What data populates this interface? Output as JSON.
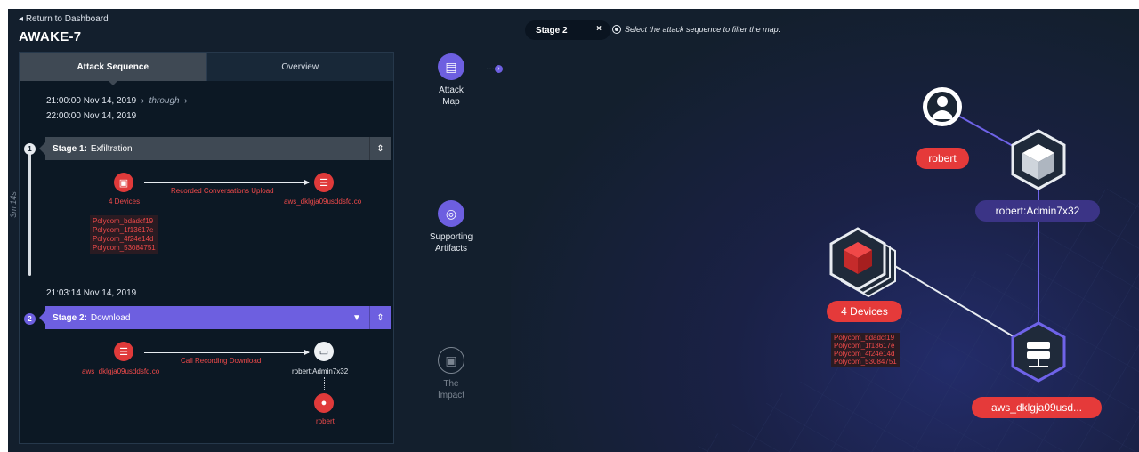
{
  "header": {
    "back_label": "Return to Dashboard",
    "title": "AWAKE-7"
  },
  "tabs": [
    {
      "label": "Attack Sequence"
    },
    {
      "label": "Overview"
    }
  ],
  "range": {
    "start": "21:00:00  Nov 14, 2019",
    "through": "through",
    "end": "22:00:00  Nov 14, 2019"
  },
  "duration": "3m 14s",
  "stage1": {
    "number": "1",
    "prefix": "Stage 1:",
    "name": "Exfiltration",
    "source_label": "4 Devices",
    "edge_label": "Recorded Conversations Upload",
    "target_label": "aws_dklgja09usddsfd.co",
    "devices": [
      "Polycom_bdadcf19",
      "Polycom_1f13617e",
      "Polycom_4f24e14d",
      "Polycom_53084751"
    ]
  },
  "stage2": {
    "time": "21:03:14  Nov 14, 2019",
    "number": "2",
    "prefix": "Stage 2:",
    "name": "Download",
    "source_label": "aws_dklgja09usddsfd.co",
    "edge_label": "Call Recording Download",
    "target_label": "robert:Admin7x32",
    "user_label": "robert"
  },
  "mid_nav": [
    {
      "label1": "Attack",
      "label2": "Map"
    },
    {
      "label1": "Supporting",
      "label2": "Artifacts"
    },
    {
      "label1": "The",
      "label2": "Impact"
    }
  ],
  "map": {
    "chip_label": "Stage 2",
    "chip_close": "×",
    "hint": "Select the attack sequence to filter the map.",
    "user_label": "robert",
    "account_label": "robert:Admin7x32",
    "devices_label": "4 Devices",
    "server_label": "aws_dklgja09usd...",
    "devices": [
      "Polycom_bdadcf19",
      "Polycom_1f13617e",
      "Polycom_4f24e14d",
      "Polycom_53084751"
    ]
  },
  "colors": {
    "accent": "#6d5fe0",
    "alert": "#e53a3a",
    "panel": "#0c1824",
    "background": "#131f2d"
  }
}
